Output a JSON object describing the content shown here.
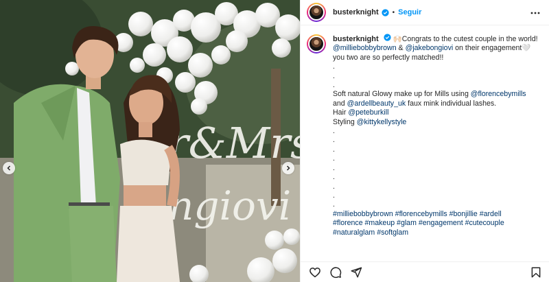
{
  "header": {
    "username": "busterknight",
    "separator": "•",
    "follow_label": "Seguir"
  },
  "caption": {
    "username": "busterknight",
    "intro": "🙌🏻Congrats to the cutest couple in the world!",
    "mention_1": "@milliebobbybrown",
    "amp_1": " & ",
    "mention_2": "@jakebongiovi",
    "engagement_text": " on their engagement🤍",
    "line_matched": "you two are so perfectly matched!!",
    "dot": ".",
    "makeup_text": "Soft natural Glowy make up for Mills using ",
    "mention_florence": "@florencebymills",
    "and_text": "and ",
    "mention_ardell": "@ardellbeauty_uk",
    "lashes_text": " faux mink individual lashes.",
    "hair_label": "Hair ",
    "mention_hair": "@peteburkill",
    "styling_label": "Styling ",
    "mention_styling": "@kittykellystyle",
    "hashtags_line1": "#milliebobbybrown #florencebymills #bonjillie #ardell",
    "hashtags_line2": "#florence #makeup #glam #engagement #cutecouple",
    "hashtags_line3": "#naturalglam #softglam"
  },
  "photo": {
    "sign_text_1": "r&Mrs",
    "sign_text_2": "ngiovi"
  },
  "icons": {
    "more": "more-horizontal-icon",
    "like": "heart-icon",
    "comment": "comment-icon",
    "share": "share-icon",
    "save": "bookmark-icon",
    "prev": "chevron-left-icon",
    "next": "chevron-right-icon"
  },
  "colors": {
    "link": "#00376b",
    "follow": "#0095f6",
    "verified": "#0095f6",
    "text": "#262626"
  }
}
